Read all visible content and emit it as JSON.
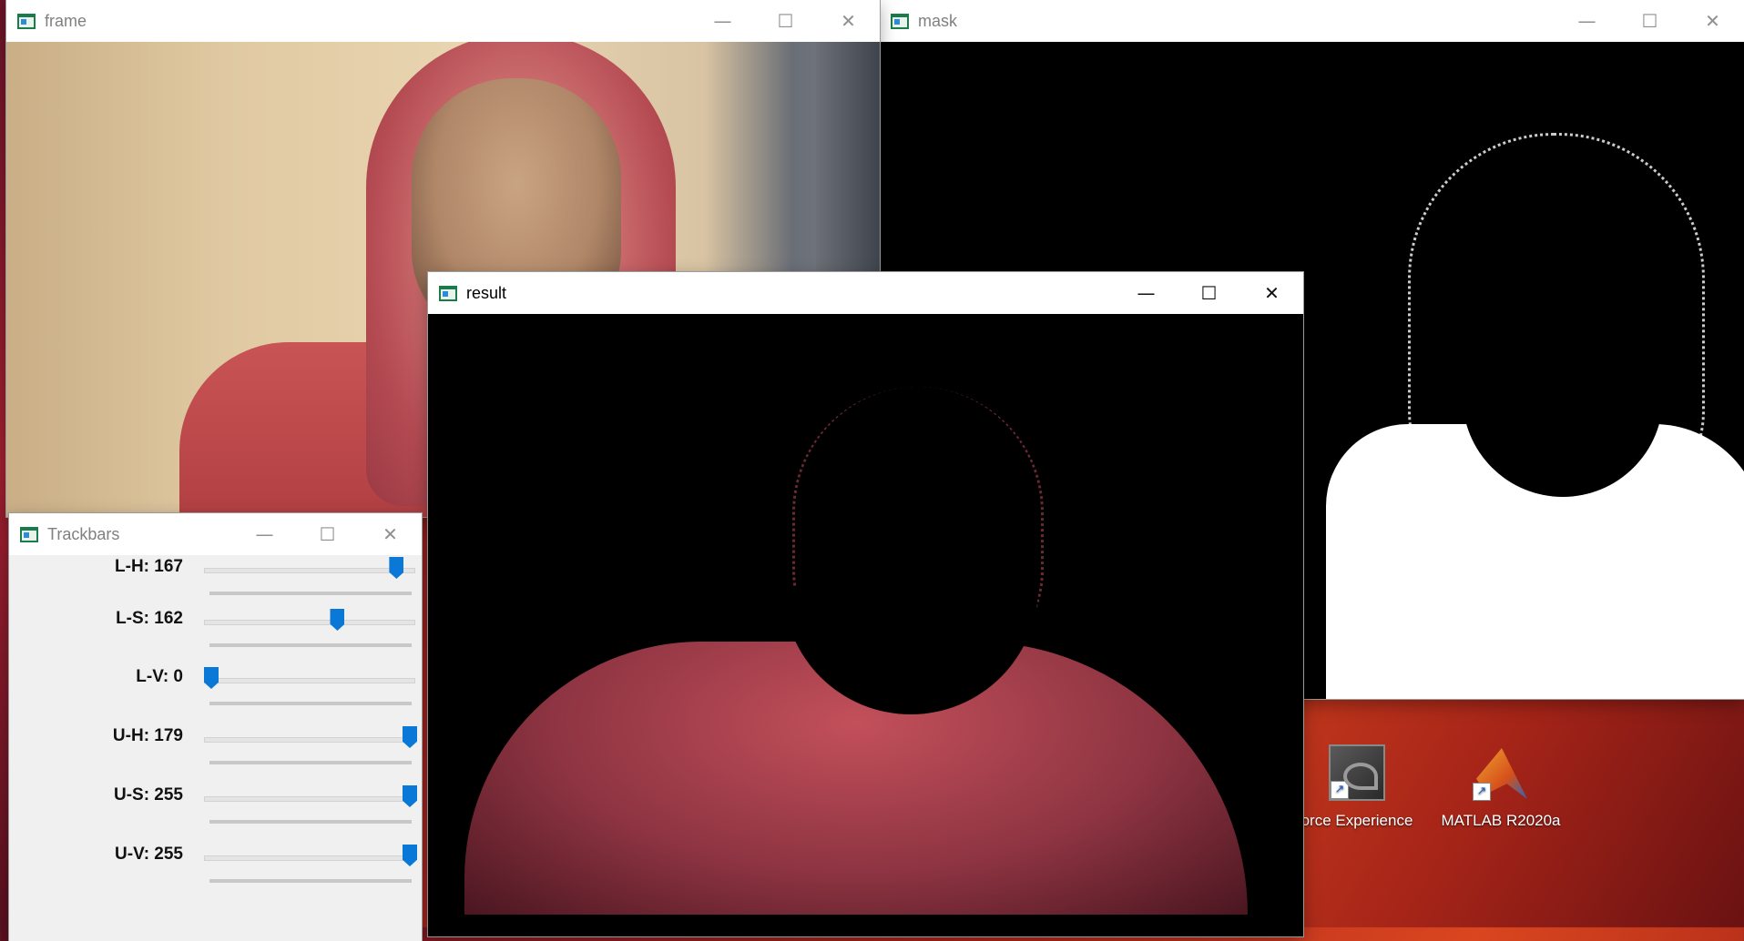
{
  "windows": {
    "frame": {
      "title": "frame"
    },
    "mask": {
      "title": "mask"
    },
    "result": {
      "title": "result"
    },
    "trackbars": {
      "title": "Trackbars"
    }
  },
  "controls": {
    "minimize": "—",
    "maximize": "☐",
    "close": "✕"
  },
  "trackbars": [
    {
      "label": "L-H: 167",
      "value": 167,
      "max": 179
    },
    {
      "label": "L-S: 162",
      "value": 162,
      "max": 255
    },
    {
      "label": "L-V: 0",
      "value": 0,
      "max": 255
    },
    {
      "label": "U-H: 179",
      "value": 179,
      "max": 179
    },
    {
      "label": "U-S: 255",
      "value": 255,
      "max": 255
    },
    {
      "label": "U-V: 255",
      "value": 255,
      "max": 255
    }
  ],
  "desktop_icons": [
    {
      "label": "orce Experience",
      "icon": "geforce-experience-icon"
    },
    {
      "label": "MATLAB R2020a",
      "icon": "matlab-icon"
    }
  ]
}
